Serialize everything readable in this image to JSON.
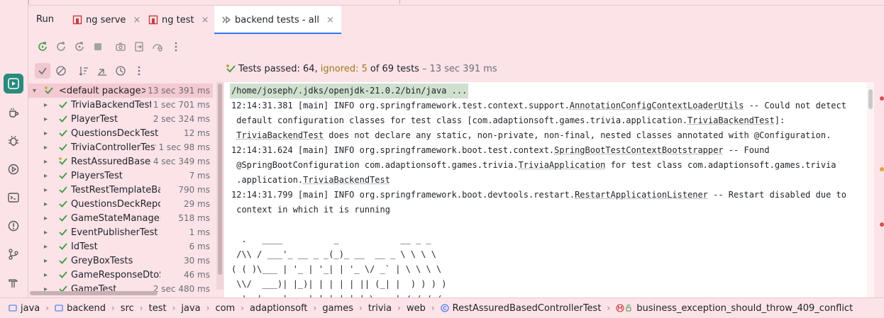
{
  "run_label": "Run",
  "tabs": [
    {
      "label": "ng serve",
      "close": "×"
    },
    {
      "label": "ng test",
      "close": "×"
    },
    {
      "label": "backend tests - all",
      "close": "×"
    }
  ],
  "status": {
    "passed": "Tests passed: 64,",
    "ignored": "ignored: 5",
    "rest": "of 69 tests",
    "time": "– 13 sec 391 ms"
  },
  "tree": {
    "root": {
      "name": "<default package>",
      "duration": "13 sec 391 ms"
    },
    "items": [
      {
        "name": "TriviaBackendTest",
        "duration": "1 sec 701 ms"
      },
      {
        "name": "PlayerTest",
        "duration": "2 sec 324 ms"
      },
      {
        "name": "QuestionsDeckTest",
        "duration": "12 ms"
      },
      {
        "name": "TriviaControllerTest",
        "duration": "1 sec 98 ms"
      },
      {
        "name": "RestAssuredBased",
        "duration": "4 sec 349 ms"
      },
      {
        "name": "PlayersTest",
        "duration": "7 ms"
      },
      {
        "name": "TestRestTemplateBased",
        "duration": "790 ms"
      },
      {
        "name": "QuestionsDeckRepository",
        "duration": "29 ms"
      },
      {
        "name": "GameStateManagerTest",
        "duration": "518 ms"
      },
      {
        "name": "EventPublisherTest",
        "duration": "1 ms"
      },
      {
        "name": "IdTest",
        "duration": "6 ms"
      },
      {
        "name": "GreyBoxTests",
        "duration": "30 ms"
      },
      {
        "name": "GameResponseDtoShould",
        "duration": "46 ms"
      },
      {
        "name": "GameTest",
        "duration": "2 sec 480 ms"
      }
    ]
  },
  "console": {
    "command": "/home/joseph/.jdks/openjdk-21.0.2/bin/java ...",
    "lines": [
      "12:14:31.381 [main] INFO org.springframework.test.context.support.AnnotationConfigContextLoaderUtils -- Could not detect",
      " default configuration classes for test class [com.adaptionsoft.games.trivia.application.TriviaBackendTest]:",
      " TriviaBackendTest does not declare any static, non-private, non-final, nested classes annotated with @Configuration.",
      "12:14:31.624 [main] INFO org.springframework.boot.test.context.SpringBootTestContextBootstrapper -- Found",
      " @SpringBootConfiguration com.adaptionsoft.games.trivia.TriviaApplication for test class com.adaptionsoft.games.trivia",
      " .application.TriviaBackendTest",
      "12:14:31.799 [main] INFO org.springframework.boot.devtools.restart.RestartApplicationListener -- Restart disabled due to",
      " context in which it is running",
      "",
      "  .   ____          _            __ _ _",
      " /\\\\ / ___'_ __ _ _(_)_ __  __ _ \\ \\ \\ \\",
      "( ( )\\___ | '_ | '_| | '_ \\/ _` | \\ \\ \\ \\",
      " \\\\/  ___)| |_)| | | | | || (_| |  ) ) ) )",
      "  '  |____| .__|_| |_|_| |_\\__, | / / / /",
      " =========|_|==============|___/=/_/_/_/"
    ]
  },
  "breadcrumb": [
    "java",
    "backend",
    "src",
    "test",
    "java",
    "com",
    "adaptionsoft",
    "games",
    "trivia",
    "web",
    "RestAssuredBasedControllerTest",
    "business_exception_should_throw_409_conflict"
  ],
  "colors": {
    "pass": "#3f9a3f",
    "ignored": "#a3781c",
    "accent": "#3574f0",
    "run_active": "#2a8a7b"
  }
}
